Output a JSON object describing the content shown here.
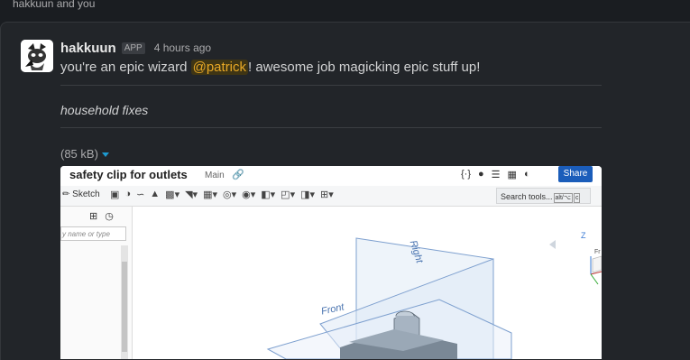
{
  "conversation": {
    "title": "hakkuun and you"
  },
  "message": {
    "author": "hakkuun",
    "badge": "APP",
    "timestamp": "4 hours ago",
    "text_before": "you're an epic wizard ",
    "mention": "@patrick",
    "text_after": "! awesome job magicking epic stuff up!",
    "attachment_title": "household fixes",
    "file_size": "(85 kB)"
  },
  "screenshot": {
    "doc_title": "safety clip for outlets",
    "branch": "Main",
    "share_label": "Share",
    "sketch_label": "Sketch",
    "search_tools_label": "Search tools...",
    "search_shortcut_1": "alt/⌥",
    "search_shortcut_2": "c",
    "filter_placeholder": "y name or type",
    "plane_right": "Right",
    "plane_front": "Front",
    "view_cube_axis": "Z",
    "view_cube_face": "Fr",
    "accent_color": "#1b5dba"
  },
  "colors": {
    "mention_bg": "#3f3514",
    "mention_fg": "#e8a826",
    "link_caret": "#1d9bd1"
  },
  "icons": [
    "raccoon-avatar",
    "chevron-down-icon",
    "link-icon",
    "bell-icon",
    "share-icon",
    "sketch-icon",
    "clock-icon"
  ]
}
